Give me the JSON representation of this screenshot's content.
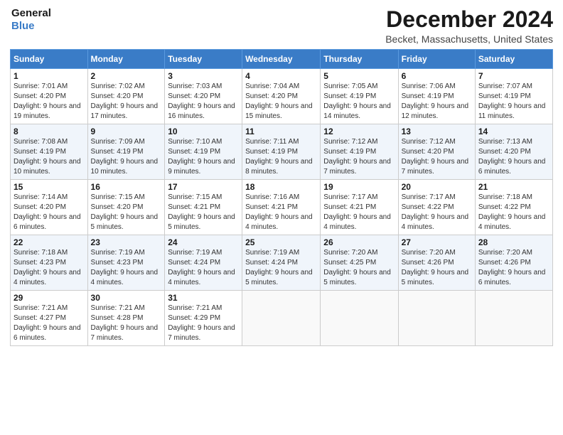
{
  "header": {
    "logo_line1": "General",
    "logo_line2": "Blue",
    "title": "December 2024",
    "location": "Becket, Massachusetts, United States"
  },
  "days_of_week": [
    "Sunday",
    "Monday",
    "Tuesday",
    "Wednesday",
    "Thursday",
    "Friday",
    "Saturday"
  ],
  "weeks": [
    [
      {
        "day": "1",
        "info": "Sunrise: 7:01 AM\nSunset: 4:20 PM\nDaylight: 9 hours and 19 minutes."
      },
      {
        "day": "2",
        "info": "Sunrise: 7:02 AM\nSunset: 4:20 PM\nDaylight: 9 hours and 17 minutes."
      },
      {
        "day": "3",
        "info": "Sunrise: 7:03 AM\nSunset: 4:20 PM\nDaylight: 9 hours and 16 minutes."
      },
      {
        "day": "4",
        "info": "Sunrise: 7:04 AM\nSunset: 4:20 PM\nDaylight: 9 hours and 15 minutes."
      },
      {
        "day": "5",
        "info": "Sunrise: 7:05 AM\nSunset: 4:19 PM\nDaylight: 9 hours and 14 minutes."
      },
      {
        "day": "6",
        "info": "Sunrise: 7:06 AM\nSunset: 4:19 PM\nDaylight: 9 hours and 12 minutes."
      },
      {
        "day": "7",
        "info": "Sunrise: 7:07 AM\nSunset: 4:19 PM\nDaylight: 9 hours and 11 minutes."
      }
    ],
    [
      {
        "day": "8",
        "info": "Sunrise: 7:08 AM\nSunset: 4:19 PM\nDaylight: 9 hours and 10 minutes."
      },
      {
        "day": "9",
        "info": "Sunrise: 7:09 AM\nSunset: 4:19 PM\nDaylight: 9 hours and 10 minutes."
      },
      {
        "day": "10",
        "info": "Sunrise: 7:10 AM\nSunset: 4:19 PM\nDaylight: 9 hours and 9 minutes."
      },
      {
        "day": "11",
        "info": "Sunrise: 7:11 AM\nSunset: 4:19 PM\nDaylight: 9 hours and 8 minutes."
      },
      {
        "day": "12",
        "info": "Sunrise: 7:12 AM\nSunset: 4:19 PM\nDaylight: 9 hours and 7 minutes."
      },
      {
        "day": "13",
        "info": "Sunrise: 7:12 AM\nSunset: 4:20 PM\nDaylight: 9 hours and 7 minutes."
      },
      {
        "day": "14",
        "info": "Sunrise: 7:13 AM\nSunset: 4:20 PM\nDaylight: 9 hours and 6 minutes."
      }
    ],
    [
      {
        "day": "15",
        "info": "Sunrise: 7:14 AM\nSunset: 4:20 PM\nDaylight: 9 hours and 6 minutes."
      },
      {
        "day": "16",
        "info": "Sunrise: 7:15 AM\nSunset: 4:20 PM\nDaylight: 9 hours and 5 minutes."
      },
      {
        "day": "17",
        "info": "Sunrise: 7:15 AM\nSunset: 4:21 PM\nDaylight: 9 hours and 5 minutes."
      },
      {
        "day": "18",
        "info": "Sunrise: 7:16 AM\nSunset: 4:21 PM\nDaylight: 9 hours and 4 minutes."
      },
      {
        "day": "19",
        "info": "Sunrise: 7:17 AM\nSunset: 4:21 PM\nDaylight: 9 hours and 4 minutes."
      },
      {
        "day": "20",
        "info": "Sunrise: 7:17 AM\nSunset: 4:22 PM\nDaylight: 9 hours and 4 minutes."
      },
      {
        "day": "21",
        "info": "Sunrise: 7:18 AM\nSunset: 4:22 PM\nDaylight: 9 hours and 4 minutes."
      }
    ],
    [
      {
        "day": "22",
        "info": "Sunrise: 7:18 AM\nSunset: 4:23 PM\nDaylight: 9 hours and 4 minutes."
      },
      {
        "day": "23",
        "info": "Sunrise: 7:19 AM\nSunset: 4:23 PM\nDaylight: 9 hours and 4 minutes."
      },
      {
        "day": "24",
        "info": "Sunrise: 7:19 AM\nSunset: 4:24 PM\nDaylight: 9 hours and 4 minutes."
      },
      {
        "day": "25",
        "info": "Sunrise: 7:19 AM\nSunset: 4:24 PM\nDaylight: 9 hours and 5 minutes."
      },
      {
        "day": "26",
        "info": "Sunrise: 7:20 AM\nSunset: 4:25 PM\nDaylight: 9 hours and 5 minutes."
      },
      {
        "day": "27",
        "info": "Sunrise: 7:20 AM\nSunset: 4:26 PM\nDaylight: 9 hours and 5 minutes."
      },
      {
        "day": "28",
        "info": "Sunrise: 7:20 AM\nSunset: 4:26 PM\nDaylight: 9 hours and 6 minutes."
      }
    ],
    [
      {
        "day": "29",
        "info": "Sunrise: 7:21 AM\nSunset: 4:27 PM\nDaylight: 9 hours and 6 minutes."
      },
      {
        "day": "30",
        "info": "Sunrise: 7:21 AM\nSunset: 4:28 PM\nDaylight: 9 hours and 7 minutes."
      },
      {
        "day": "31",
        "info": "Sunrise: 7:21 AM\nSunset: 4:29 PM\nDaylight: 9 hours and 7 minutes."
      },
      {
        "day": "",
        "info": ""
      },
      {
        "day": "",
        "info": ""
      },
      {
        "day": "",
        "info": ""
      },
      {
        "day": "",
        "info": ""
      }
    ]
  ]
}
